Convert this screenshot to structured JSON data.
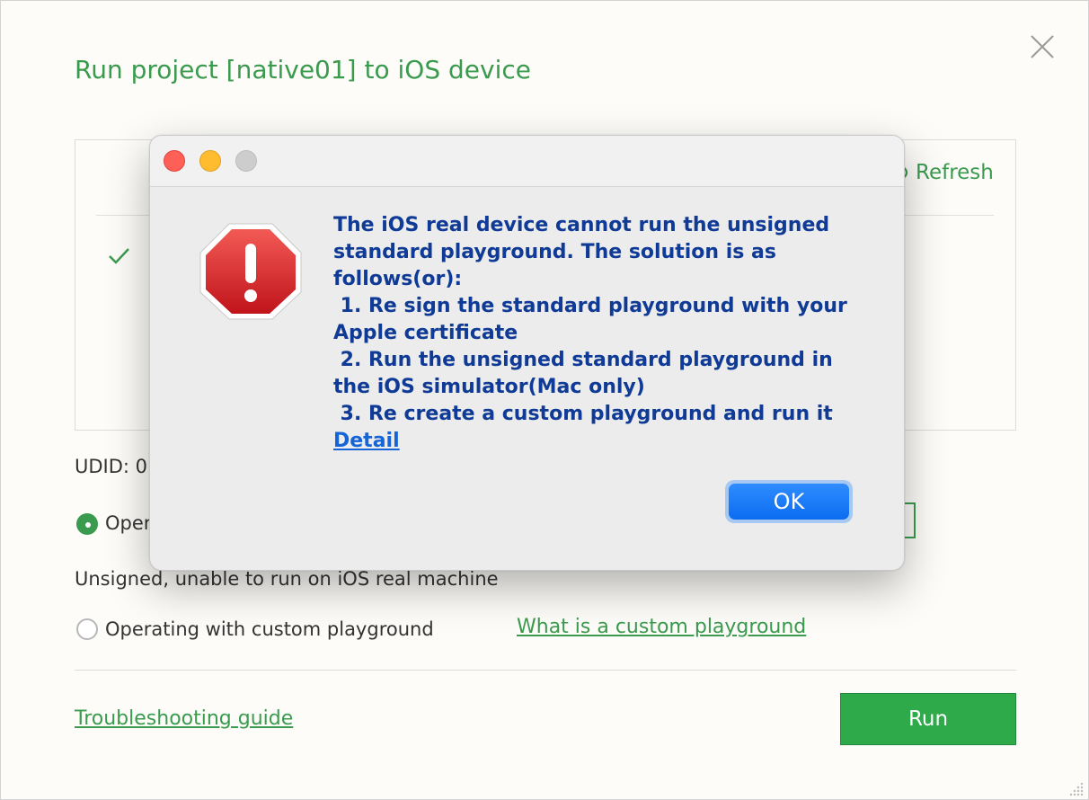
{
  "window": {
    "title": "Run project [native01] to iOS device"
  },
  "device_panel": {
    "refresh_label": "Refresh"
  },
  "udid_label": "UDID: 0",
  "options": {
    "standard_label": "Oper",
    "unsigned_note": "Unsigned, unable to run on iOS real machine",
    "custom_label": "Operating with custom playground",
    "custom_link": "What is a custom playground"
  },
  "footer": {
    "troubleshooting_link": "Troubleshooting guide",
    "run_label": "Run"
  },
  "alert": {
    "message_lines": [
      "The iOS real device cannot run the unsigned",
      "standard playground. The solution is as",
      "follows(or):",
      " 1. Re sign the standard playground with your",
      "Apple certificate",
      " 2. Run the unsigned standard playground in",
      "the iOS simulator(Mac only)",
      " 3. Re create a custom playground and run it"
    ],
    "detail_link": "Detail",
    "ok_label": "OK"
  },
  "colors": {
    "accent": "#3a9b4f",
    "run_button": "#2eaa4a",
    "alert_text": "#0f3a96",
    "link_blue": "#1565d8",
    "ok_button": "#0b6cf0"
  },
  "icons": [
    "close-icon",
    "refresh-icon",
    "check-icon",
    "stop-alert-icon",
    "resize-grip-icon"
  ]
}
